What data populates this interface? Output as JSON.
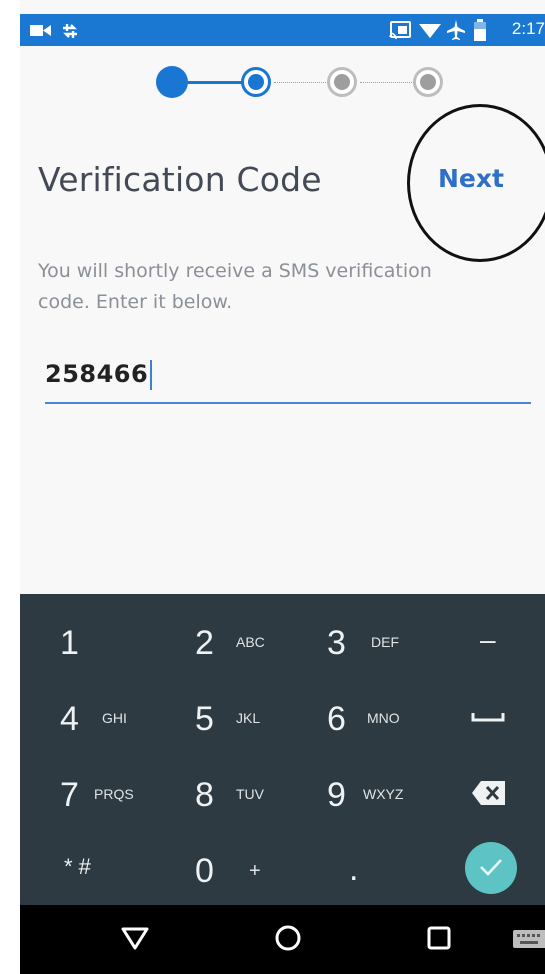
{
  "status_bar": {
    "time": "2:17",
    "icons": [
      "video-icon",
      "sync-icon",
      "cast-icon",
      "wifi-icon",
      "airplane-icon",
      "battery-icon"
    ]
  },
  "stepper": {
    "total_steps": 4,
    "current_step": 2,
    "active_color": "#1976d2",
    "inactive_color": "#9e9e9e"
  },
  "page": {
    "title": "Verification Code",
    "next_label": "Next",
    "description": "You will shortly receive a SMS verification code. Enter it below.",
    "code_value": "258466"
  },
  "keyboard": {
    "rows": [
      [
        {
          "main": "1",
          "sub": ""
        },
        {
          "main": "2",
          "sub": "ABC"
        },
        {
          "main": "3",
          "sub": "DEF"
        },
        {
          "main": "–",
          "sub": ""
        }
      ],
      [
        {
          "main": "4",
          "sub": "GHI"
        },
        {
          "main": "5",
          "sub": "JKL"
        },
        {
          "main": "6",
          "sub": "MNO"
        },
        {
          "main": "",
          "sub": "space-icon"
        }
      ],
      [
        {
          "main": "7",
          "sub": "PRQS"
        },
        {
          "main": "8",
          "sub": "TUV"
        },
        {
          "main": "9",
          "sub": "WXYZ"
        },
        {
          "main": "",
          "sub": "backspace-icon"
        }
      ],
      [
        {
          "main": "* #",
          "sub": ""
        },
        {
          "main": "0",
          "sub": "+"
        },
        {
          "main": ".",
          "sub": ""
        },
        {
          "main": "",
          "sub": "done-check-icon"
        }
      ]
    ],
    "key_1": "1",
    "key_2": "2",
    "key_2_sub": "ABC",
    "key_3": "3",
    "key_3_sub": "DEF",
    "key_dash": "–",
    "key_4": "4",
    "key_4_sub": "GHI",
    "key_5": "5",
    "key_5_sub": "JKL",
    "key_6": "6",
    "key_6_sub": "MNO",
    "key_7": "7",
    "key_7_sub": "PRQS",
    "key_8": "8",
    "key_8_sub": "TUV",
    "key_9": "9",
    "key_9_sub": "WXYZ",
    "key_star_hash": "* #",
    "key_0": "0",
    "key_0_sub": "+",
    "key_dot": ".",
    "done_color": "#5ec3c5"
  },
  "nav_bar": {
    "buttons": [
      "back-icon",
      "home-icon",
      "recents-icon",
      "keyboard-switch-icon"
    ]
  }
}
